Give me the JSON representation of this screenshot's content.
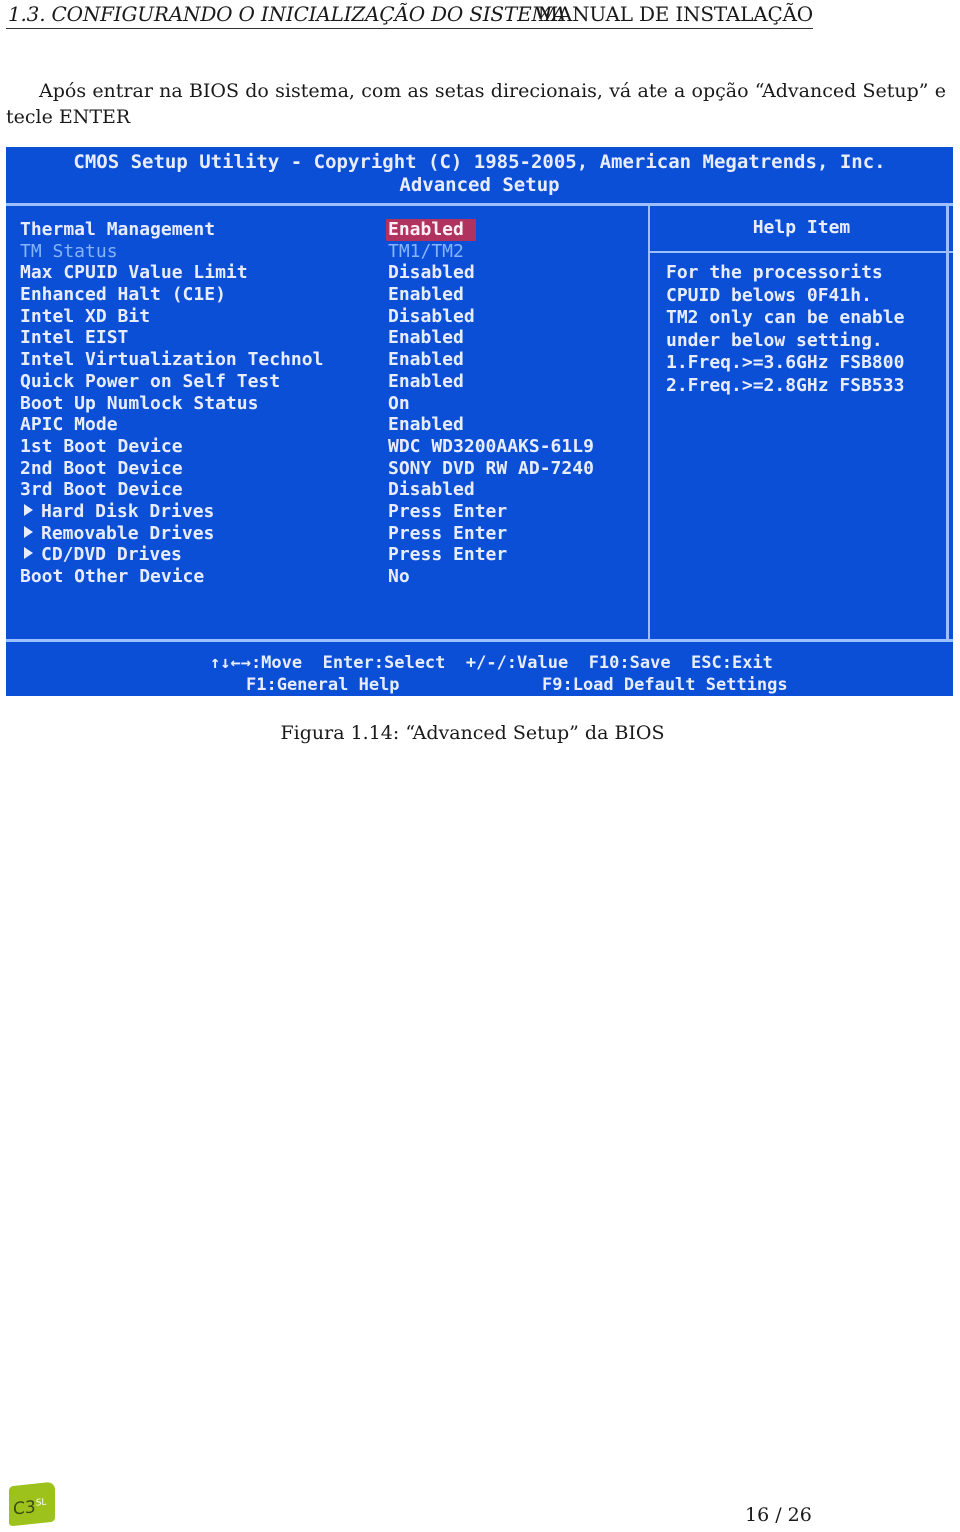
{
  "header": {
    "section": "1.3.  CONFIGURANDO O INICIALIZAÇÃO DO SISTEMA",
    "doc_title": "MANUAL DE INSTALAÇÃO"
  },
  "paragraph": "Após entrar na BIOS do sistema, com as setas direcionais, vá ate a opção “Advanced Setup” e tecle ENTER",
  "bios": {
    "banner_line1": "CMOS Setup Utility - Copyright (C) 1985-2005, American Megatrends, Inc.",
    "banner_line2": "Advanced Setup",
    "colors": {
      "background": "#0a4fd6",
      "selection": "#b0325e",
      "border": "#9cc0ff",
      "dim_text": "#86b4ff"
    },
    "settings": [
      {
        "label": "Thermal Management",
        "value": "Enabled",
        "selected": true
      },
      {
        "label": "TM Status",
        "value": "TM1/TM2",
        "dim": true
      },
      {
        "label": "Max CPUID Value Limit",
        "value": "Disabled"
      },
      {
        "label": "Enhanced Halt (C1E)",
        "value": "Enabled"
      },
      {
        "label": "Intel XD Bit",
        "value": "Disabled"
      },
      {
        "label": "Intel EIST",
        "value": "Enabled"
      },
      {
        "label": "Intel Virtualization Technol",
        "value": "Enabled"
      },
      {
        "label": "Quick Power on Self Test",
        "value": "Enabled"
      },
      {
        "label": "Boot Up Numlock Status",
        "value": "On"
      },
      {
        "label": "APIC Mode",
        "value": "Enabled"
      },
      {
        "label": "1st Boot Device",
        "value": "WDC WD3200AAKS-61L9"
      },
      {
        "label": "2nd Boot Device",
        "value": "SONY DVD RW AD-7240"
      },
      {
        "label": "3rd Boot Device",
        "value": "Disabled"
      },
      {
        "label": "Hard Disk Drives",
        "value": "Press Enter",
        "submenu": true
      },
      {
        "label": "Removable Drives",
        "value": "Press Enter",
        "submenu": true
      },
      {
        "label": "CD/DVD Drives",
        "value": "Press Enter",
        "submenu": true
      },
      {
        "label": "Boot Other Device",
        "value": "No"
      }
    ],
    "help": {
      "title": "Help Item",
      "lines": [
        "For the processorits",
        "CPUID belows 0F41h.",
        "TM2 only can be enable",
        "under below setting.",
        "1.Freq.>=3.6GHz FSB800",
        "2.Freq.>=2.8GHz FSB533"
      ]
    },
    "footer": {
      "line1": "↑↓←→:Move  Enter:Select  +/-/:Value  F10:Save  ESC:Exit",
      "line2_left": "F1:General Help",
      "line2_right": "F9:Load Default Settings"
    }
  },
  "caption": "Figura 1.14: “Advanced Setup” da BIOS",
  "logo": {
    "text": "C3",
    "sup": "SL"
  },
  "page_number": "16 / 26"
}
